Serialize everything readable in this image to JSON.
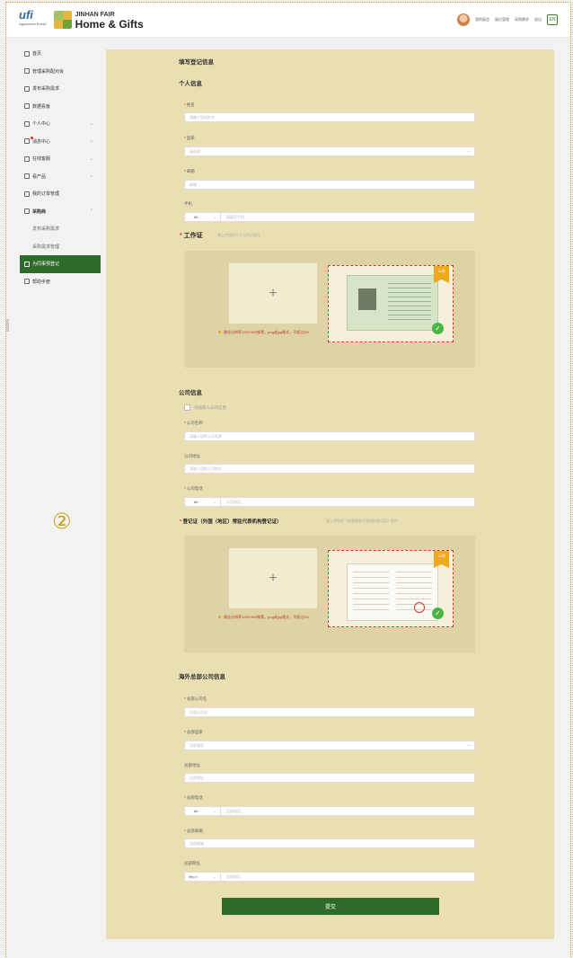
{
  "header": {
    "ufi_logo": "ufi",
    "ufi_sub": "Approved Event",
    "brand_line1": "JINHAN FAIR",
    "brand_line2": "Home & Gifts",
    "links": [
      "我的展会",
      "展位管理",
      "采购需求",
      "退出"
    ],
    "lang": "EN"
  },
  "sidebar": {
    "items": [
      {
        "label": "首页"
      },
      {
        "label": "管理采购配对会"
      },
      {
        "label": "发布采购需求"
      },
      {
        "label": "数据看板"
      },
      {
        "label": "个人中心"
      },
      {
        "label": "消息中心"
      },
      {
        "label": "在线客服"
      },
      {
        "label": "看产品"
      },
      {
        "label": "我的订单管理"
      },
      {
        "label": "采购商"
      },
      {
        "label": "发布采购需求"
      },
      {
        "label": "采购需求管理"
      },
      {
        "label": "为同事预登记"
      },
      {
        "label": "帮助手册"
      }
    ]
  },
  "form": {
    "page_title": "填写登记信息",
    "personal": {
      "title": "个人信息",
      "name_label": "姓名",
      "name_placeholder": "请输入您的姓名",
      "country_label": "国家",
      "country_placeholder": "请选择",
      "email_label": "邮箱",
      "email_placeholder": "邮箱",
      "phone_label": "手机",
      "phone_prefix": "86",
      "phone_placeholder": "请填写手机",
      "workcert_label": "工作证",
      "workcert_hint": "请上传您的个人工作证照片",
      "upload_note": "最佳分辨率1200*800像素，png或jpg格式，不超过2M",
      "sample_tag": "示例"
    },
    "company": {
      "title": "公司信息",
      "checkbox_label": "添加新人公司信息",
      "name_label": "公司名称",
      "name_placeholder": "请输入您的公司名称",
      "address_label": "公司地址",
      "address_placeholder": "请输入您的公司地址",
      "phone_label": "公司电话",
      "phone_prefix": "86",
      "phone_placeholder": "公司电话",
      "regcert_label": "登记证（外国（地区）常驻代表机构登记证）",
      "regcert_hint": "请上传您的《外国常驻代表机构登记证》照片",
      "upload_note": "最佳分辨率1200*800像素，png或jpg格式，不超过2M",
      "sample_tag": "示例"
    },
    "overseas": {
      "title": "海外总部公司信息",
      "name_label": "总部公司名",
      "name_placeholder": "总部公司名",
      "country_label": "总部国家",
      "country_placeholder": "总部国家",
      "address_label": "总部地址",
      "address_placeholder": "总部地址",
      "phone_label": "总部电话",
      "phone_prefix": "86",
      "phone_placeholder": "总部电话",
      "email_label": "总部邮箱",
      "email_placeholder": "总部邮箱",
      "website_label": "总部网址",
      "website_prefix": "http://",
      "website_placeholder": "总部网址"
    },
    "submit_label": "提交"
  },
  "annotation": "②",
  "colors": {
    "accent": "#2e6b2a",
    "panel": "#e9dfb2",
    "frame": "#c9a21d"
  }
}
